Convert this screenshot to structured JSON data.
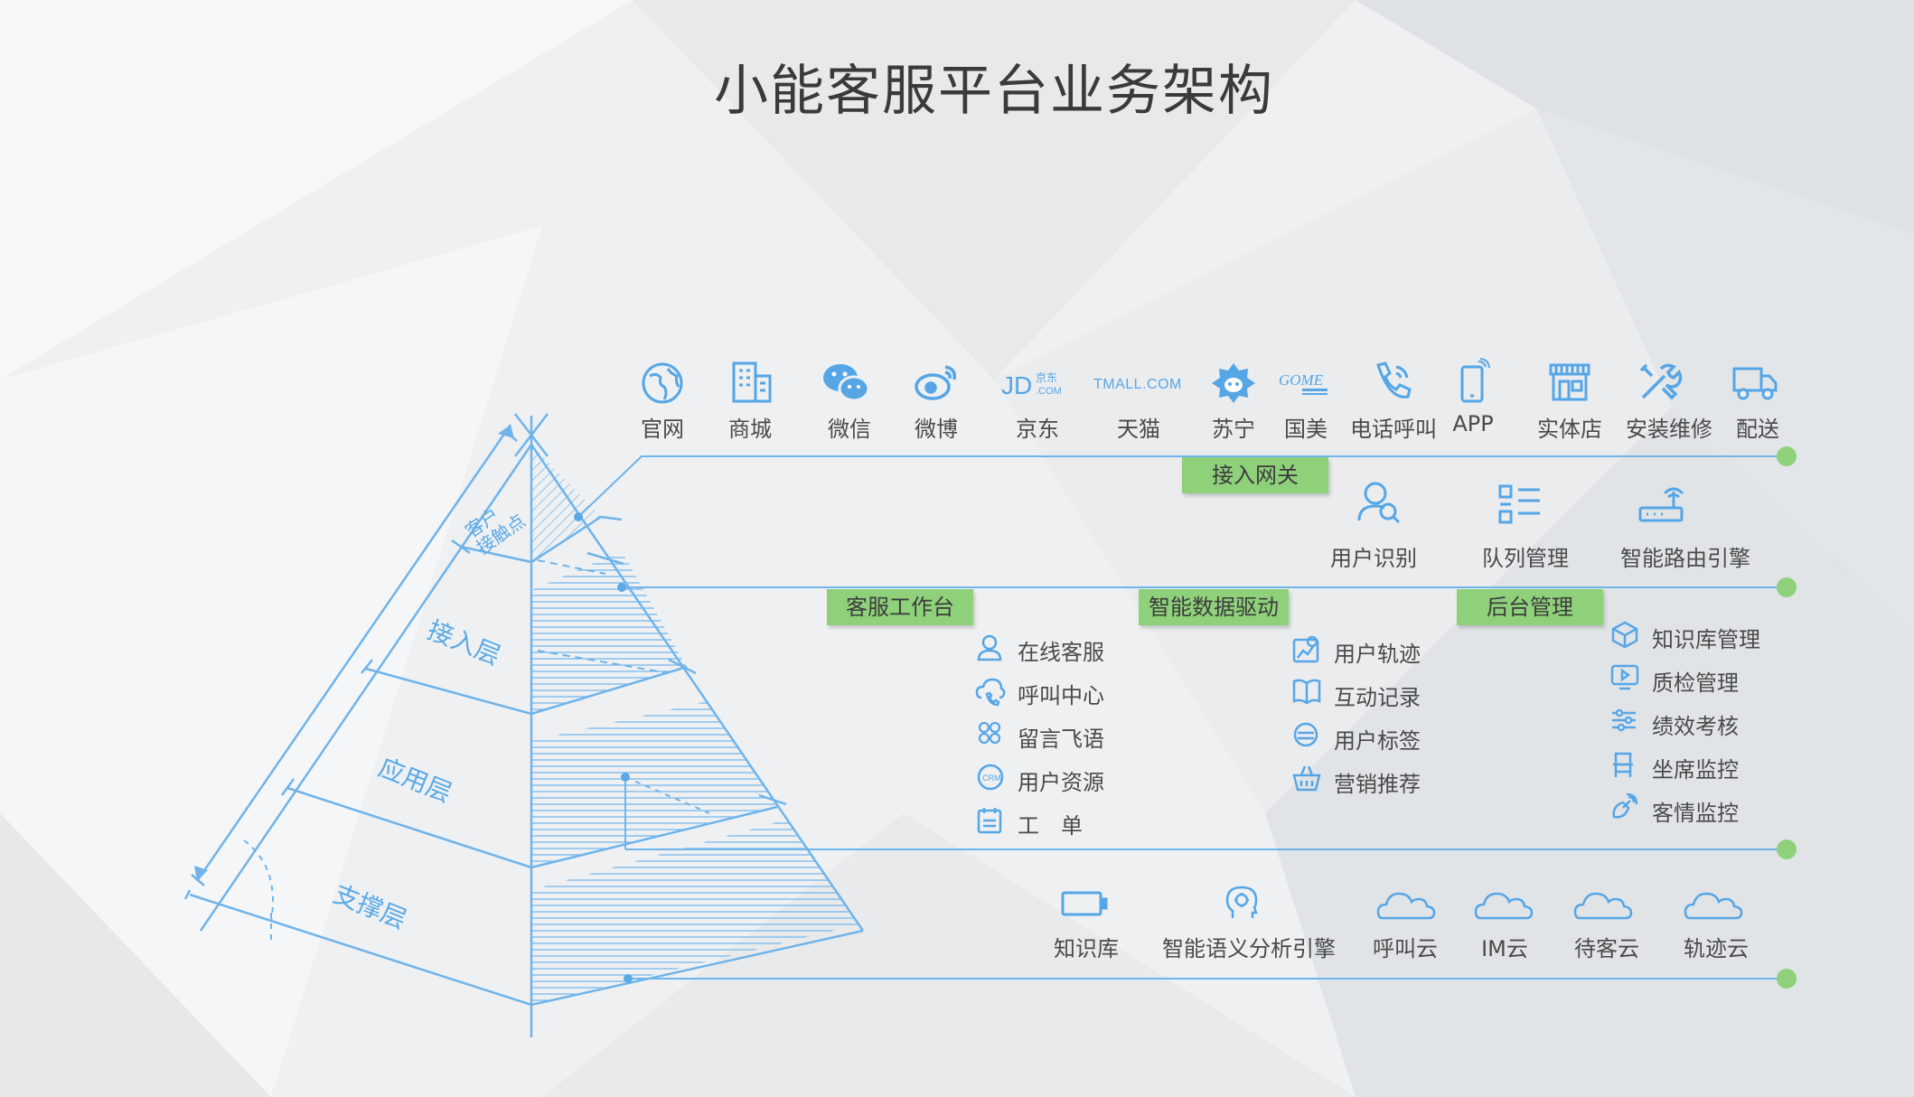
{
  "title": "小能客服平台业务架构",
  "colors": {
    "line": "#6fb4ea",
    "icon": "#56a6e6",
    "tag": "#8ed17a",
    "dot": "#8ed17a"
  },
  "pyramid": {
    "layers": [
      "客户接触点",
      "接入层",
      "应用层",
      "支撑层"
    ],
    "top_label_line1": "客户",
    "top_label_line2": "接触点"
  },
  "channels": [
    {
      "label": "官网",
      "icon": "globe-icon"
    },
    {
      "label": "商城",
      "icon": "building-icon"
    },
    {
      "label": "微信",
      "icon": "wechat-icon"
    },
    {
      "label": "微博",
      "icon": "weibo-icon"
    },
    {
      "label": "京东",
      "icon": "jd-logo-icon",
      "logo_text": "JD",
      "logo_sub1": "京东",
      "logo_sub2": ".COM"
    },
    {
      "label": "天猫",
      "icon": "tmall-logo-icon",
      "logo_text": "TMALL.COM"
    },
    {
      "label": "苏宁",
      "icon": "suning-logo-icon"
    },
    {
      "label": "国美",
      "icon": "gome-logo-icon",
      "logo_text": "GOME"
    },
    {
      "label": "电话呼叫",
      "icon": "phone-icon"
    },
    {
      "label": "APP",
      "icon": "mobile-icon"
    },
    {
      "label": "实体店",
      "icon": "store-icon"
    },
    {
      "label": "安装维修",
      "icon": "tools-icon"
    },
    {
      "label": "配送",
      "icon": "truck-icon"
    }
  ],
  "gateway": {
    "tag": "接入网关",
    "items": [
      {
        "label": "用户识别",
        "icon": "user-search-icon"
      },
      {
        "label": "队列管理",
        "icon": "list-icon"
      },
      {
        "label": "智能路由引擎",
        "icon": "router-icon"
      }
    ]
  },
  "application": {
    "workbench": {
      "tag": "客服工作台",
      "items": [
        {
          "label": "在线客服",
          "icon": "agent-icon"
        },
        {
          "label": "呼叫中心",
          "icon": "cloud-phone-icon"
        },
        {
          "label": "留言飞语",
          "icon": "message-icon"
        },
        {
          "label": "用户资源",
          "icon": "crm-icon"
        },
        {
          "label": "工　单",
          "icon": "form-icon"
        }
      ]
    },
    "data_driven": {
      "tag": "智能数据驱动",
      "items": [
        {
          "label": "用户轨迹",
          "icon": "track-icon"
        },
        {
          "label": "互动记录",
          "icon": "book-icon"
        },
        {
          "label": "用户标签",
          "icon": "tag-user-icon"
        },
        {
          "label": "营销推荐",
          "icon": "basket-icon"
        }
      ]
    },
    "backend": {
      "tag": "后台管理",
      "items": [
        {
          "label": "知识库管理",
          "icon": "box-icon"
        },
        {
          "label": "质检管理",
          "icon": "play-icon"
        },
        {
          "label": "绩效考核",
          "icon": "sliders-icon"
        },
        {
          "label": "坐席监控",
          "icon": "seat-icon"
        },
        {
          "label": "客情监控",
          "icon": "satellite-icon"
        }
      ]
    }
  },
  "support": [
    {
      "label": "知识库",
      "icon": "battery-icon"
    },
    {
      "label": "智能语义分析引擎",
      "icon": "brain-icon"
    },
    {
      "label": "呼叫云",
      "icon": "cloud-icon"
    },
    {
      "label": "IM云",
      "icon": "cloud-icon"
    },
    {
      "label": "待客云",
      "icon": "cloud-icon"
    },
    {
      "label": "轨迹云",
      "icon": "cloud-icon"
    }
  ]
}
